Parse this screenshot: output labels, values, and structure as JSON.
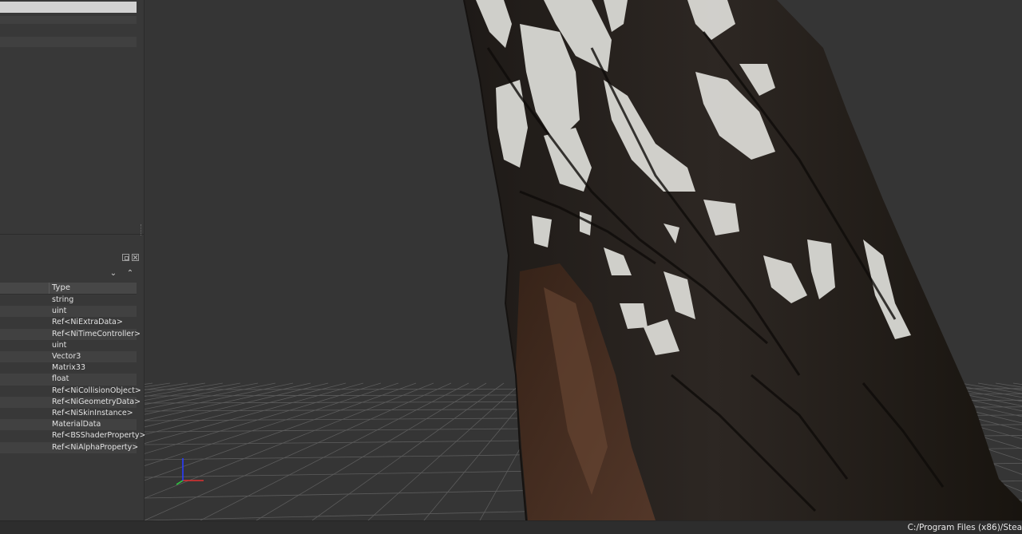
{
  "block_details": {
    "column_header": "Type",
    "rows": [
      {
        "type": "string"
      },
      {
        "type": "uint"
      },
      {
        "type": "Ref<NiExtraData>"
      },
      {
        "type": "Ref<NiTimeController>"
      },
      {
        "type": "uint"
      },
      {
        "type": "Vector3"
      },
      {
        "type": "Matrix33"
      },
      {
        "type": "float"
      },
      {
        "type": "Ref<NiCollisionObject>"
      },
      {
        "type": "Ref<NiGeometryData>"
      },
      {
        "type": "Ref<NiSkinInstance>"
      },
      {
        "type": "MaterialData"
      },
      {
        "type": "Ref<BSShaderProperty>"
      },
      {
        "type": "Ref<NiAlphaProperty>"
      }
    ]
  },
  "dock": {
    "nav_down_glyph": "⌄",
    "nav_up_glyph": "⌃"
  },
  "viewport": {
    "axis_colors": {
      "x": "#e03030",
      "y": "#2ecc40",
      "z": "#2a3cff"
    }
  },
  "status_bar": {
    "path": "C:/Program Files (x86)/Stea"
  }
}
